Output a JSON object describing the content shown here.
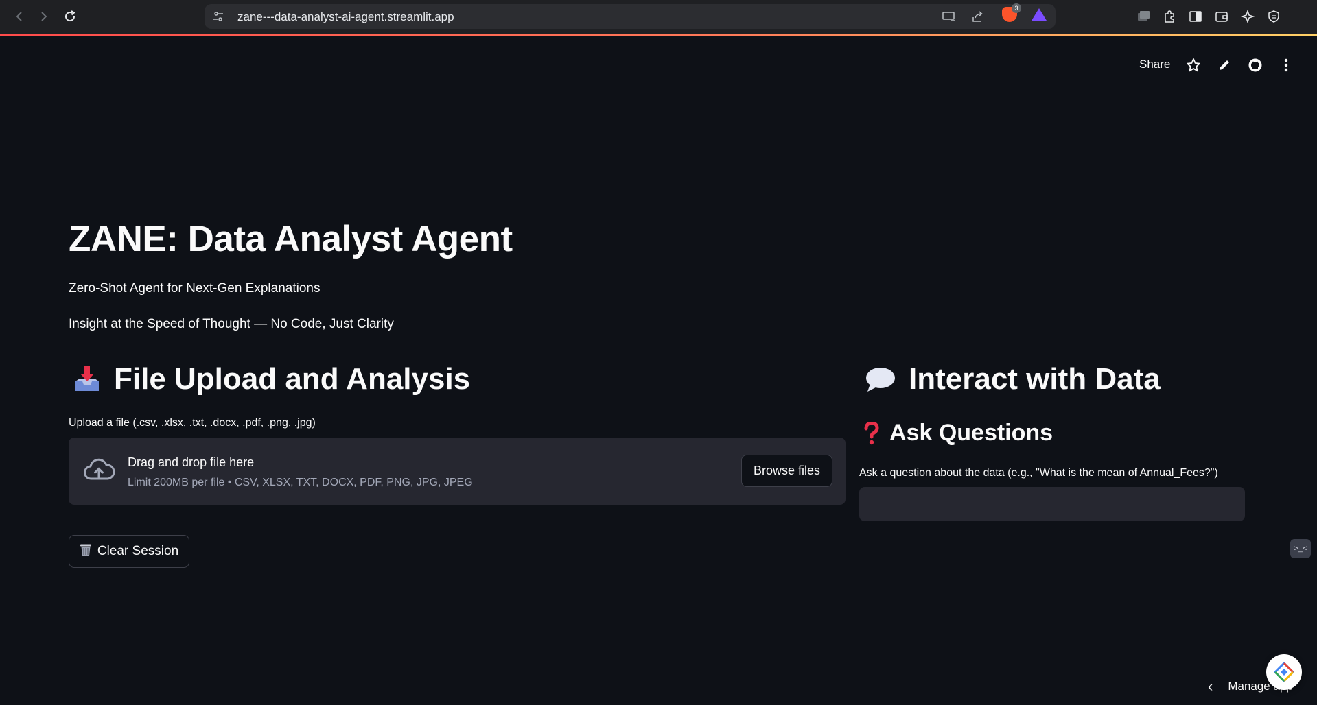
{
  "browser": {
    "url": "zane---data-analyst-ai-agent.streamlit.app",
    "brave_shield_count": "3"
  },
  "toolbar": {
    "share_label": "Share",
    "icons": [
      "star-icon",
      "pencil-icon",
      "github-icon",
      "more-vertical-icon"
    ]
  },
  "header": {
    "title": "ZANE: Data Analyst Agent",
    "subtitle": "Zero-Shot Agent for Next-Gen Explanations",
    "tagline": "Insight at the Speed of Thought — No Code, Just Clarity"
  },
  "upload_section": {
    "heading": "File Upload and Analysis",
    "upload_label": "Upload a file (.csv, .xlsx, .txt, .docx, .pdf, .png, .jpg)",
    "dropzone_text": "Drag and drop file here",
    "dropzone_limit": "Limit 200MB per file • CSV, XLSX, TXT, DOCX, PDF, PNG, JPG, JPEG",
    "browse_label": "Browse files",
    "clear_label": "Clear Session"
  },
  "interact_section": {
    "heading": "Interact with Data",
    "ask_heading": "Ask Questions",
    "ask_label": "Ask a question about the data (e.g., \"What is the mean of Annual_Fees?\")",
    "ask_value": ""
  },
  "footer": {
    "manage_app_label": "Manage app"
  },
  "colors": {
    "background": "#0e1117",
    "widget_bg": "#262730",
    "text": "#fafafa",
    "muted_text": "#a3a8b8",
    "accent": "#ff4b4b"
  }
}
